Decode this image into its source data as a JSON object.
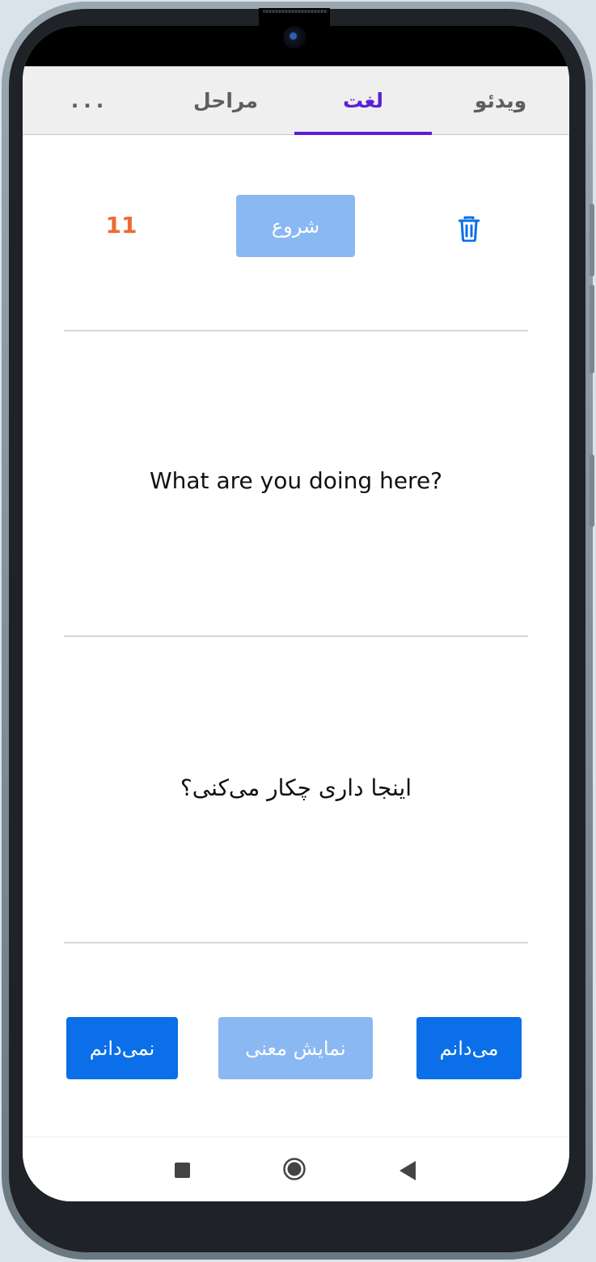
{
  "tabs": [
    {
      "label": "ویدئو",
      "active": false
    },
    {
      "label": "لغت",
      "active": true
    },
    {
      "label": "مراحل",
      "active": false
    },
    {
      "label": "...",
      "active": false
    }
  ],
  "toolbar": {
    "start_label": "شروع",
    "counter": "11"
  },
  "card": {
    "english": "What are you doing here?",
    "persian": "اینجا داری چکار می‌کنی؟"
  },
  "actions": {
    "know_label": "می‌دانم",
    "show_meaning_label": "نمایش معنی",
    "dont_know_label": "نمی‌دانم"
  },
  "colors": {
    "accent_tab": "#5a1fd8",
    "primary_button": "#0a6fe8",
    "disabled_button": "#8ab8f2",
    "counter": "#ee6a34"
  },
  "icons": {
    "trash": "trash-icon",
    "recent": "recent-apps-icon",
    "home": "home-icon",
    "back": "back-icon"
  }
}
